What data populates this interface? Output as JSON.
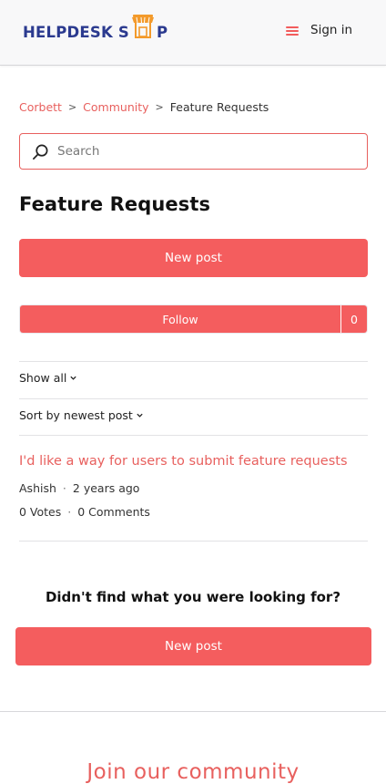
{
  "header": {
    "logo_text_left": "HELPDESK S",
    "logo_text_right": "P",
    "logo_icon": "storefront-icon",
    "menu_icon": "hamburger-menu-icon",
    "signin_label": "Sign in"
  },
  "breadcrumb": {
    "items": [
      "Corbett",
      "Community",
      "Feature Requests"
    ],
    "separator": ">"
  },
  "search": {
    "placeholder": "Search",
    "value": ""
  },
  "page": {
    "title": "Feature Requests",
    "new_post_label": "New post",
    "follow_label": "Follow",
    "follow_count": "0"
  },
  "filters": {
    "show_label": "Show all",
    "sort_label": "Sort by newest post"
  },
  "posts": [
    {
      "title": "I'd like a way for users to submit feature requests",
      "author": "Ashish",
      "time": "2 years ago",
      "votes": "0 Votes",
      "comments": "0 Comments"
    }
  ],
  "footer_cta": {
    "question": "Didn't find what you were looking for?",
    "new_post_label": "New post",
    "join_text": "Join our community"
  },
  "colors": {
    "accent": "#f45d5e",
    "link": "#e8605e",
    "logo_blue": "#2b3a8f",
    "logo_orange": "#f39a2b"
  }
}
